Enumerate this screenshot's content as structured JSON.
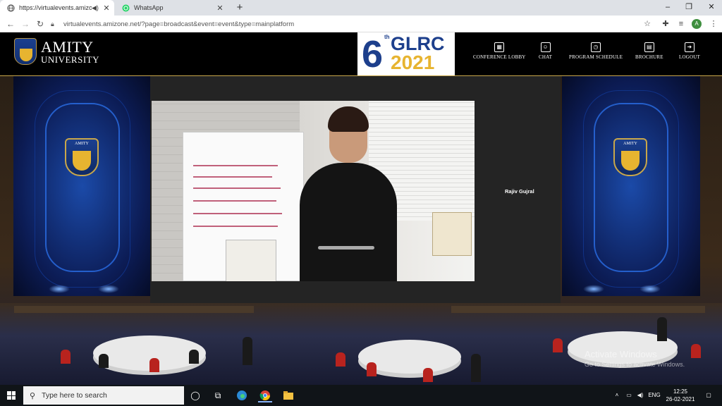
{
  "browser": {
    "tabs": [
      {
        "title": "https://virtualevents.amizone",
        "active": true
      },
      {
        "title": "WhatsApp",
        "active": false
      }
    ],
    "new_tab": "+",
    "url": "virtualevents.amizone.net/?page=broadcast&event=event&type=mainplatform",
    "profile_initial": "A",
    "window_controls": {
      "minimize": "–",
      "maximize": "❐",
      "close": "✕"
    }
  },
  "site": {
    "logo": {
      "line1": "AMITY",
      "line2": "UNIVERSITY"
    },
    "event_badge": {
      "number": "6",
      "sup": "th",
      "name": "GLRC",
      "year": "2021"
    },
    "nav": [
      {
        "label": "CONFERENCE LOBBY",
        "icon": "lobby-icon"
      },
      {
        "label": "CHAT",
        "icon": "chat-icon"
      },
      {
        "label": "PROGRAM SCHEDULE",
        "icon": "schedule-icon"
      },
      {
        "label": "BROCHURE",
        "icon": "brochure-icon"
      },
      {
        "label": "LOGOUT",
        "icon": "logout-icon"
      }
    ]
  },
  "stage": {
    "panel_crest_text": "AMITY",
    "speaker_name": "Rajiv Gujral"
  },
  "watermark": {
    "line1": "Activate Windows",
    "line2": "Go to Settings to activate Windows."
  },
  "taskbar": {
    "search_placeholder": "Type here to search",
    "language": "ENG",
    "time": "12:25",
    "date": "26-02-2021"
  }
}
